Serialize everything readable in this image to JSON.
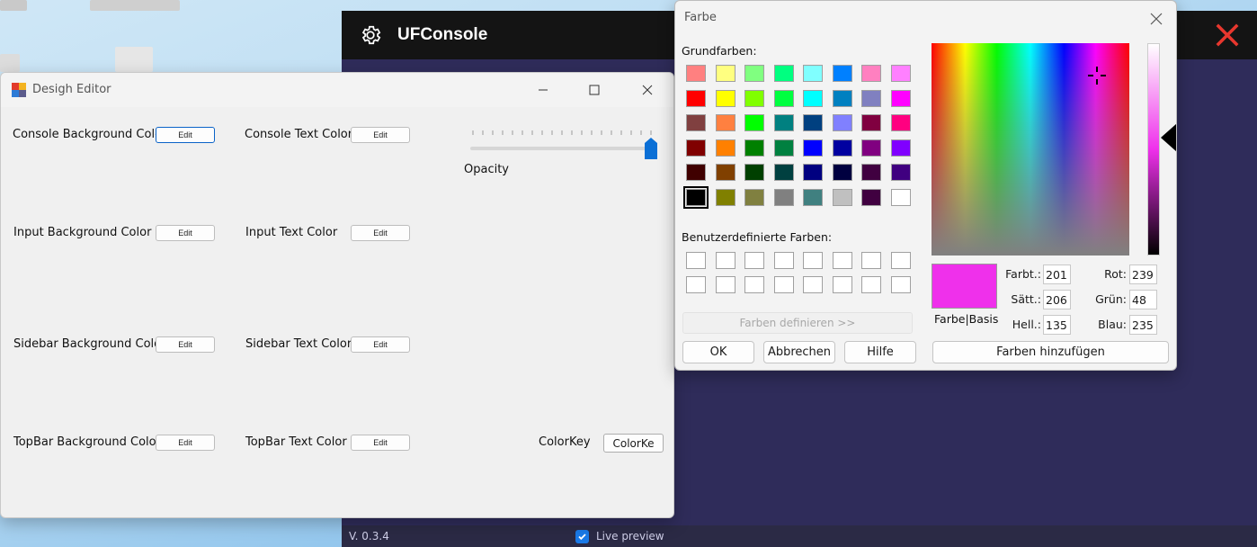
{
  "console": {
    "title": "UFConsole",
    "icon": "gear-icon",
    "close_icon": "close-x-icon",
    "close_color": "#e8372e",
    "background": "#2f2c5a",
    "version": "V. 0.3.4",
    "live_preview_label": "Live preview",
    "live_preview_checked": true
  },
  "editor": {
    "title": "Desigh Editor",
    "rows": [
      {
        "left_label": "Console Background Color",
        "left_button": "Edit",
        "right_label": "Console Text Color",
        "right_button": "Edit"
      },
      {
        "left_label": "Input Background Color",
        "left_button": "Edit",
        "right_label": "Input Text Color",
        "right_button": "Edit"
      },
      {
        "left_label": "Sidebar Background Color",
        "left_button": "Edit",
        "right_label": "Sidebar Text Color",
        "right_button": "Edit"
      },
      {
        "left_label": "TopBar Background Color",
        "left_button": "Edit",
        "right_label": "TopBar Text Color",
        "right_button": "Edit"
      }
    ],
    "opacity_label": "Opacity",
    "opacity_value": 1.0,
    "colorkey_label": "ColorKey",
    "colorkey_button": "ColorKe"
  },
  "farbe": {
    "title": "Farbe",
    "basic_colors_label": "Grundfarben:",
    "basic_colors": [
      [
        "#ff8080",
        "#ffff80",
        "#80ff80",
        "#00ff80",
        "#80ffff",
        "#0080ff",
        "#ff80c0",
        "#ff80ff"
      ],
      [
        "#ff0000",
        "#ffff00",
        "#80ff00",
        "#00ff40",
        "#00ffff",
        "#0080c0",
        "#8080c0",
        "#ff00ff"
      ],
      [
        "#804040",
        "#ff8040",
        "#00ff00",
        "#008080",
        "#004080",
        "#8080ff",
        "#800040",
        "#ff0080"
      ],
      [
        "#800000",
        "#ff8000",
        "#008000",
        "#008040",
        "#0000ff",
        "#0000a0",
        "#800080",
        "#8000ff"
      ],
      [
        "#400000",
        "#804000",
        "#004000",
        "#004040",
        "#000080",
        "#000040",
        "#400040",
        "#400080"
      ],
      [
        "#000000",
        "#808000",
        "#808040",
        "#808080",
        "#408080",
        "#c0c0c0",
        "#400040",
        "#ffffff"
      ]
    ],
    "selected_basic": "#000000",
    "custom_colors_label": "Benutzerdefinierte Farben:",
    "custom_colors": [
      "#ffffff",
      "#ffffff",
      "#ffffff",
      "#ffffff",
      "#ffffff",
      "#ffffff",
      "#ffffff",
      "#ffffff",
      "#ffffff",
      "#ffffff",
      "#ffffff",
      "#ffffff",
      "#ffffff",
      "#ffffff",
      "#ffffff",
      "#ffffff"
    ],
    "define_button": "Farben definieren >>",
    "ok_button": "OK",
    "cancel_button": "Abbrechen",
    "help_button": "Hilfe",
    "add_button": "Farben hinzufügen",
    "preview_label": "Farbe|Basis",
    "preview_color": "#ef30eb",
    "hue_label": "Farbt.:",
    "hue": "201",
    "sat_label": "Sätt.:",
    "sat": "206",
    "lum_label": "Hell.:",
    "lum": "135",
    "red_label": "Rot:",
    "red": "239",
    "green_label": "Grün:",
    "green": "48",
    "blue_label": "Blau:",
    "blue": "235"
  }
}
